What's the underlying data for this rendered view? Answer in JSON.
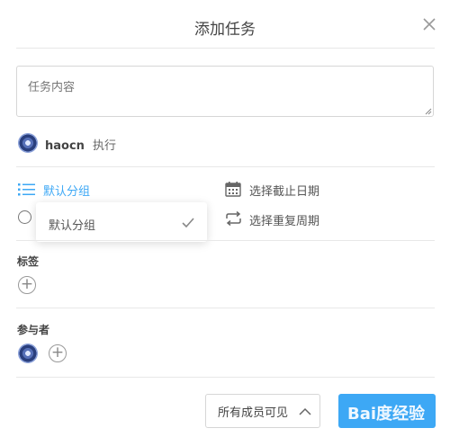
{
  "dialog": {
    "title": "添加任务"
  },
  "task": {
    "content_placeholder": "任务内容"
  },
  "executor": {
    "name": "haocn",
    "role": "执行"
  },
  "options": {
    "group_label": "默认分组",
    "deadline_label": "选择截止日期",
    "repeat_label": "选择重复周期"
  },
  "group_dropdown": {
    "items": [
      {
        "label": "默认分组",
        "selected": true
      }
    ]
  },
  "tags": {
    "label": "标签"
  },
  "participants": {
    "label": "参与者"
  },
  "footer": {
    "visibility_label": "所有成员可见",
    "watermark": "Bai度经验"
  },
  "colors": {
    "accent": "#3da8f5",
    "divider": "#e8e8e8",
    "text": "#444444"
  },
  "icons": {
    "close": "close-icon",
    "list": "list-icon",
    "calendar": "calendar-icon",
    "repeat": "repeat-icon",
    "check": "check-icon",
    "add": "plus-circle-icon",
    "chevron": "chevron-up-icon"
  }
}
